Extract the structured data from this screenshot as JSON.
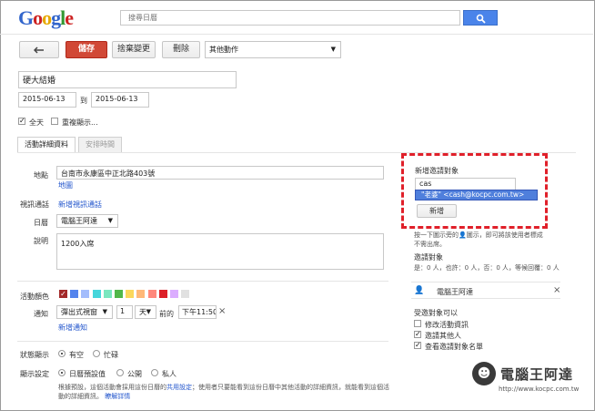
{
  "header": {
    "logo_letters": [
      "G",
      "o",
      "o",
      "g",
      "l",
      "e"
    ],
    "search_placeholder": "搜尋日曆"
  },
  "toolbar": {
    "back_icon": "arrow-left-icon",
    "save_label": "儲存",
    "discard_label": "捨棄變更",
    "delete_label": "刪除",
    "more_actions_label": "其他動作"
  },
  "event": {
    "title": "硬大結婚",
    "start_date": "2015-06-13",
    "to_label": "到",
    "end_date": "2015-06-13",
    "allday_label": "全天",
    "allday_checked": true,
    "repeat_label": "重複顯示..."
  },
  "tabs": {
    "details": "活動詳細資料",
    "schedule": "安排時間"
  },
  "details": {
    "where_label": "地點",
    "where_value": "台南市永康區中正北路403號",
    "map_link": "地圖",
    "video_label": "視訊通話",
    "video_link": "新增視訊通話",
    "calendar_label": "日曆",
    "calendar_value": "電腦王阿達",
    "description_label": "說明",
    "description_value": "1200入席",
    "color_label": "活動顏色",
    "colors": [
      "#a32929",
      "#5484ed",
      "#a4bdfc",
      "#46d6db",
      "#7ae7bf",
      "#51b749",
      "#fbd75b",
      "#ffb878",
      "#ff887c",
      "#dc2127",
      "#dbadff",
      "#e1e1e1"
    ],
    "notify_label": "通知",
    "notify_type": "彈出式視窗",
    "notify_amount": "1",
    "notify_unit": "天",
    "notify_before": "前的",
    "notify_time": "下午11:50",
    "notify_remove": "×",
    "add_notify_link": "新增通知",
    "status_label": "狀態顯示",
    "status_free": "有空",
    "status_busy": "忙碌",
    "privacy_label": "顯示設定",
    "privacy_default": "日曆預設值",
    "privacy_public": "公開",
    "privacy_private": "私人",
    "privacy_note_1": "根據預設，這個活動會採用這份日曆的",
    "privacy_note_link": "共用設定",
    "privacy_note_2": "；使用者只要能看到這份日曆中其他活動的詳細資訊，就能看到這個活動的詳細資訊。",
    "privacy_more_link": "瞭解詳情"
  },
  "guests": {
    "add_title": "新增邀請對象",
    "input_value": "cas",
    "suggestion": "\"老婆\" <cash@kocpc.com.tw>",
    "add_button": "新增",
    "hint_1": "按一下圖示旁的",
    "hint_2": "圖示，即可將該使用者標成",
    "hint_3": "不需出席。",
    "invited_title": "邀請對象",
    "rsvp_summary": "是：0 人，也許：0 人，否：0 人，等候回覆：0 人",
    "guest_name": "電腦王阿達",
    "guest_remove": "×",
    "perm_title": "受邀對象可以",
    "perm_modify": "修改活動資訊",
    "perm_modify_checked": false,
    "perm_invite": "邀請其他人",
    "perm_invite_checked": true,
    "perm_see": "查看邀請對象名單",
    "perm_see_checked": true
  },
  "watermark": {
    "title": "電腦王阿達",
    "url": "http://www.kocpc.com.tw"
  }
}
